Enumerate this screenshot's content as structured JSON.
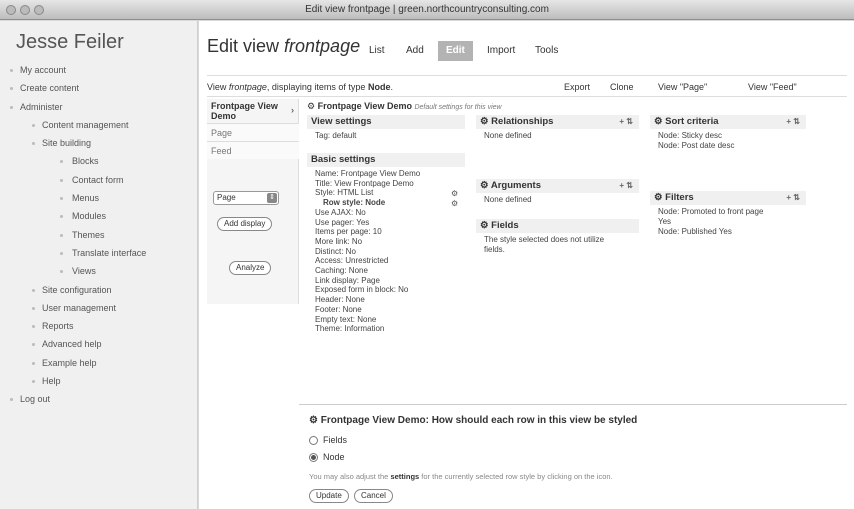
{
  "window": {
    "title": "Edit view frontpage | green.northcountryconsulting.com"
  },
  "sidebar": {
    "site_name": "Jesse Feiler",
    "items": [
      {
        "label": "My account",
        "level": 0
      },
      {
        "label": "Create content",
        "level": 0
      },
      {
        "label": "Administer",
        "level": 0
      },
      {
        "label": "Content management",
        "level": 1
      },
      {
        "label": "Site building",
        "level": 1
      },
      {
        "label": "Blocks",
        "level": 2
      },
      {
        "label": "Contact form",
        "level": 2
      },
      {
        "label": "Menus",
        "level": 2
      },
      {
        "label": "Modules",
        "level": 2
      },
      {
        "label": "Themes",
        "level": 2
      },
      {
        "label": "Translate interface",
        "level": 2
      },
      {
        "label": "Views",
        "level": 2
      },
      {
        "label": "Site configuration",
        "level": 1
      },
      {
        "label": "User management",
        "level": 1
      },
      {
        "label": "Reports",
        "level": 1
      },
      {
        "label": "Advanced help",
        "level": 1
      },
      {
        "label": "Example help",
        "level": 1
      },
      {
        "label": "Help",
        "level": 1
      },
      {
        "label": "Log out",
        "level": 0
      }
    ]
  },
  "header": {
    "title_plain": "Edit view ",
    "title_italic": "frontpage",
    "tabs": [
      {
        "label": "List",
        "active": false
      },
      {
        "label": "Add",
        "active": false
      },
      {
        "label": "Edit",
        "active": true
      },
      {
        "label": "Import",
        "active": false
      },
      {
        "label": "Tools",
        "active": false
      }
    ]
  },
  "infobar": {
    "prefix": "View ",
    "view_name": "frontpage",
    "middle": ", displaying items of type ",
    "type": "Node",
    "suffix": ".",
    "links": [
      "Export",
      "Clone",
      "View \"Page\"",
      "View \"Feed\""
    ]
  },
  "displays": {
    "header": "Frontpage View Demo",
    "arrow": "›",
    "items": [
      "Page",
      "Feed"
    ],
    "select_value": "Page",
    "add_display_label": "Add display",
    "analyze_label": "Analyze"
  },
  "overview": {
    "heading": "Frontpage View Demo",
    "subheading": "Default settings for this view"
  },
  "view_settings": {
    "title": "View settings",
    "lines": [
      "Tag: default"
    ]
  },
  "basic_settings": {
    "title": "Basic settings",
    "lines": [
      "Name: Frontpage View Demo",
      "Title: View Frontpage Demo",
      "Style: HTML List",
      "Row style: Node",
      "Use AJAX: No",
      "Use pager: Yes",
      "Items per page: 10",
      "More link: No",
      "Distinct: No",
      "Access: Unrestricted",
      "Caching: None",
      "Link display: Page",
      "Exposed form in block: No",
      "Header: None",
      "Footer: None",
      "Empty text: None",
      "Theme: Information"
    ]
  },
  "relationships": {
    "title": "Relationships",
    "lines": [
      "None defined"
    ]
  },
  "arguments": {
    "title": "Arguments",
    "lines": [
      "None defined"
    ]
  },
  "fields": {
    "title": "Fields",
    "lines": [
      "The style selected does not utilize",
      "fields."
    ]
  },
  "sort_criteria": {
    "title": "Sort criteria",
    "lines": [
      "Node: Sticky desc",
      "Node: Post date desc"
    ]
  },
  "filters": {
    "title": "Filters",
    "lines": [
      "Node: Promoted to front page",
      "Yes",
      "Node: Published Yes"
    ]
  },
  "config": {
    "question": "Frontpage View Demo: How should each row in this view be styled",
    "options": [
      {
        "label": "Fields",
        "selected": false
      },
      {
        "label": "Node",
        "selected": true
      }
    ],
    "hint_before": "You may also adjust the ",
    "hint_bold": "settings",
    "hint_after": " for the currently selected row style by clicking on the icon.",
    "update_label": "Update",
    "cancel_label": "Cancel"
  }
}
